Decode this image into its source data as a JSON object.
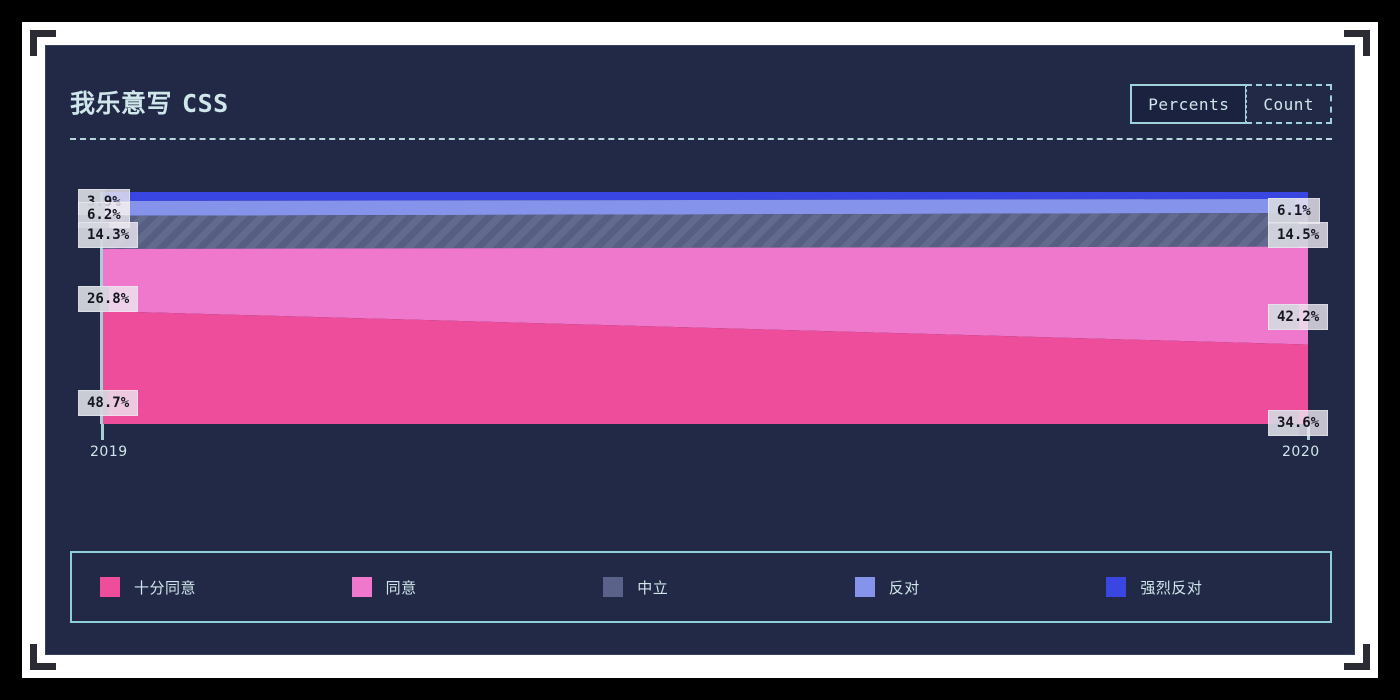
{
  "header": {
    "title_cjk": "我乐意写",
    "title_latin": "CSS",
    "toggle": {
      "percents_label": "Percents",
      "count_label": "Count",
      "active": "Percents"
    }
  },
  "chart_data": {
    "type": "area",
    "title": "我乐意写 CSS",
    "subtitle": "",
    "xlabel": "",
    "ylabel": "",
    "categories": [
      "2019",
      "2020"
    ],
    "x_tick_labels": [
      "2019",
      "2020"
    ],
    "ylim": [
      0,
      100
    ],
    "grid": false,
    "legend_position": "bottom",
    "stack_order_bottom_to_top": [
      "十分同意",
      "同意",
      "中立",
      "反对",
      "强烈反对"
    ],
    "series": [
      {
        "name": "十分同意",
        "color": "#ee4d9b",
        "values": [
          48.7,
          34.6
        ],
        "labels": [
          "48.7%",
          "34.6%"
        ]
      },
      {
        "name": "同意",
        "color": "#ef78cd",
        "values": [
          26.8,
          42.2
        ],
        "labels": [
          "26.8%",
          "42.2%"
        ]
      },
      {
        "name": "中立",
        "color": "#5a628a",
        "values": [
          14.3,
          14.5
        ],
        "labels": [
          "14.3%",
          "14.5%"
        ],
        "pattern": "diagonal-stripes"
      },
      {
        "name": "反对",
        "color": "#8593ea",
        "values": [
          6.2,
          6.1
        ],
        "labels": [
          "6.2%",
          "6.1%"
        ]
      },
      {
        "name": "强烈反对",
        "color": "#3a46e1",
        "values": [
          3.9,
          2.6
        ],
        "labels": [
          "3.9%",
          ""
        ]
      }
    ],
    "labels_left": [
      "3.9%",
      "6.2%",
      "14.3%",
      "26.8%",
      "48.7%"
    ],
    "labels_right": [
      "6.1%",
      "14.5%",
      "42.2%",
      "34.6%"
    ]
  },
  "legend": {
    "items": [
      {
        "label": "十分同意",
        "color": "#ee4d9b"
      },
      {
        "label": "同意",
        "color": "#ef78cd"
      },
      {
        "label": "中立",
        "color": "#5a628a"
      },
      {
        "label": "反对",
        "color": "#8593ea"
      },
      {
        "label": "强烈反对",
        "color": "#3a46e1"
      }
    ]
  },
  "axis": {
    "left_tick_label": "2019",
    "right_tick_label": "2020"
  }
}
